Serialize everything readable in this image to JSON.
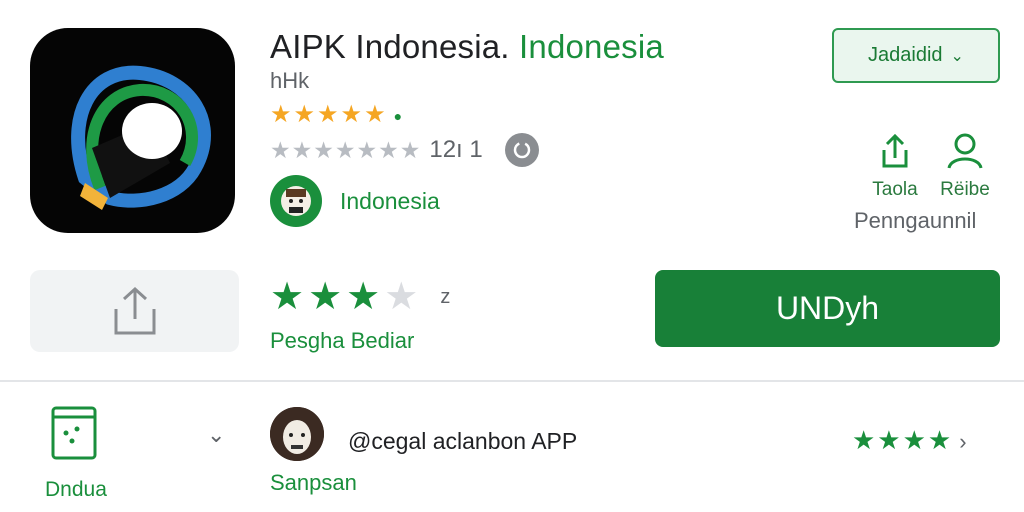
{
  "app": {
    "title_main": "AIPK Indonesia.",
    "title_accent": "Indonesia",
    "subtitle": "hHk",
    "gold_stars": "★★★★★",
    "grey_stars": "★★★★★★★",
    "grey_count": "12ı 1",
    "developer": "Indonesia"
  },
  "dropdown": {
    "label": "Jadaidid"
  },
  "actions": {
    "share_label": "Taola",
    "user_label": "Rëibe",
    "caption": "Penngaunnil"
  },
  "rating": {
    "value": 3.5,
    "max": 5,
    "number": "z",
    "label": "Pesgha Bediar"
  },
  "install": {
    "label": "UNDyh"
  },
  "bottom": {
    "label": "Dndua",
    "review_title": "@cegal aclanbon APP",
    "reviewer": "Sanpsan",
    "review_stars": "★★★★"
  },
  "colors": {
    "brand": "#1a8f3c",
    "install": "#188038",
    "star_gold": "#f5a623"
  }
}
